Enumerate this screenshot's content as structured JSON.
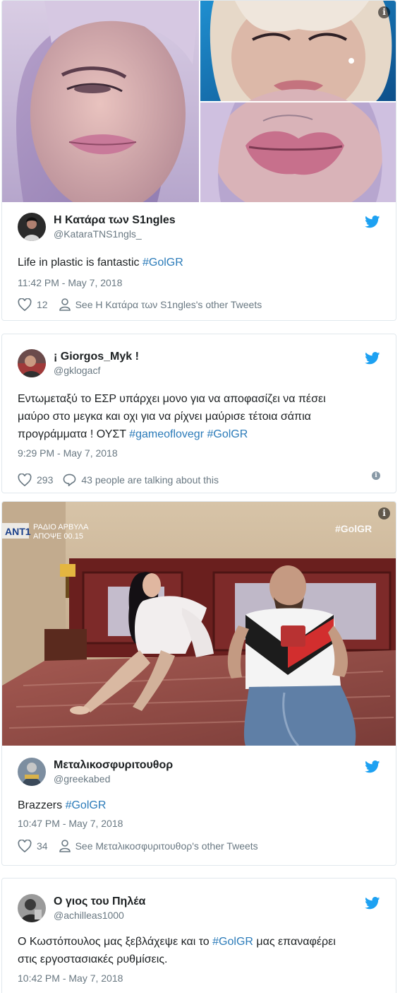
{
  "tweets": [
    {
      "name": "Η Κατάρα των S1ngles",
      "handle": "@KataraTNS1ngls_",
      "text": "Life in plastic is fantastic ",
      "hashtags": [
        "#GolGR"
      ],
      "time": "11:42 PM - May 7, 2018",
      "likes": "12",
      "secondary": "See Η Κατάρα των S1ngles's other Tweets",
      "secondary_icon": "person-icon"
    },
    {
      "name": "¡ Giorgos_Myk !",
      "handle": "@gklogacf",
      "text_lines": [
        "Εντωμεταξύ το ΕΣΡ υπάρχει μονο για να αποφασίζει να πέσει",
        "μαύρο στο μεγκα και οχι για να ρίχνει μαύρισε τέτοια σάπια",
        "προγράμματα ! ΟΥΣΤ "
      ],
      "hashtags": [
        "#gameoflovegr",
        "#GolGR"
      ],
      "time": "9:29 PM - May 7, 2018",
      "likes": "293",
      "secondary": "43 people are talking about this",
      "secondary_icon": "speech-bubble-icon"
    },
    {
      "name": "Μεταλικοσφυριτουθορ",
      "handle": "@greekabed",
      "text": "Brazzers ",
      "hashtags": [
        "#GolGR"
      ],
      "time": "10:47 PM - May 7, 2018",
      "likes": "34",
      "secondary": "See Μεταλικοσφυριτουθορ's other Tweets",
      "secondary_icon": "person-icon",
      "tv_overlay": {
        "channel": "ANT1",
        "show_line1": "ΡΑΔΙΟ ΑΡΒΥΛΑ",
        "show_line2": "ΑΠΟΨΕ 00.15",
        "hashtag": "#GolGR"
      }
    },
    {
      "name": "Ο γιος του Πηλέα",
      "handle": "@achilleas1000",
      "text_line1": "Ο Κωστόπουλος μας ξεβλάχεψε και το ",
      "hashtag_inline": "#GolGR",
      "text_line1_end": " μας επαναφέρει",
      "text_line2": "στις εργοστασιακές ρυθμίσεις.",
      "time": "10:42 PM - May 7, 2018"
    }
  ],
  "icons": {
    "like": "heart-icon",
    "brand": "twitter-bird-icon",
    "info": "info-icon"
  },
  "colors": {
    "link": "#2b7bb9",
    "brand": "#1da1f2",
    "muted": "#697882",
    "border": "#e1e8ed"
  }
}
